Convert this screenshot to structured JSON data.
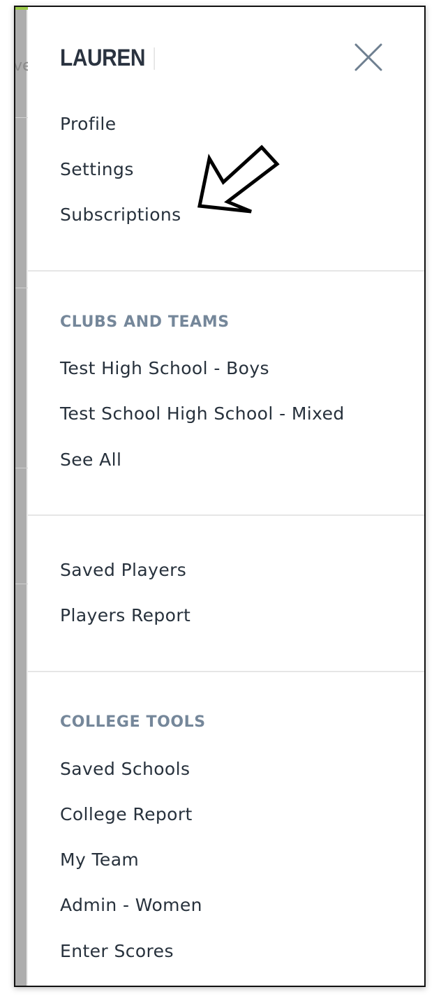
{
  "background": {
    "fragment_text": "ve"
  },
  "header": {
    "brand": "LAUREN",
    "close_icon": "close-x-icon"
  },
  "account": {
    "items": [
      {
        "label": "Profile"
      },
      {
        "label": "Settings"
      },
      {
        "label": "Subscriptions"
      }
    ]
  },
  "annotation": {
    "icon": "pointing-arrow-icon"
  },
  "clubs": {
    "title": "CLUBS AND TEAMS",
    "items": [
      {
        "label": "Test High School - Boys"
      },
      {
        "label": "Test School High School - Mixed"
      },
      {
        "label": "See All"
      }
    ]
  },
  "players": {
    "items": [
      {
        "label": "Saved Players"
      },
      {
        "label": "Players Report"
      }
    ]
  },
  "college": {
    "title": "COLLEGE TOOLS",
    "items": [
      {
        "label": "Saved Schools"
      },
      {
        "label": "College Report"
      },
      {
        "label": "My Team"
      },
      {
        "label": "Admin - Women"
      },
      {
        "label": "Enter Scores"
      }
    ]
  },
  "colors": {
    "text": "#27313c",
    "section_title": "#75879a",
    "divider": "#e6e6e6",
    "close_icon": "#6e7f90"
  }
}
